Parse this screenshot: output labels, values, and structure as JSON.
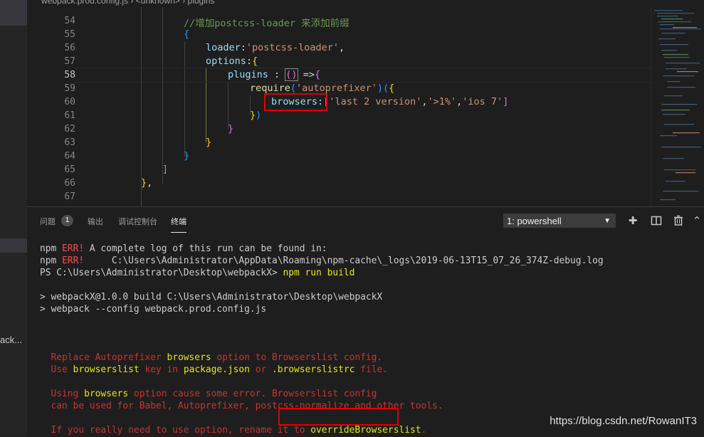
{
  "breadcrumb": {
    "file": "webpack.prod.config.js",
    "sep1": "›",
    "scope": "<unknown>",
    "sep2": "›",
    "symbol": "plugins"
  },
  "left_fragment": "ack...",
  "editor": {
    "lines": [
      {
        "num": "54",
        "comment": "//增加postcss-loader 来添加前缀"
      },
      {
        "num": "55",
        "brace": "{"
      },
      {
        "num": "56",
        "key": "loader",
        "colon": ":",
        "str": "'postcss-loader'",
        "comma": ","
      },
      {
        "num": "57",
        "key": "options",
        "colon": ":",
        "brace": "{"
      },
      {
        "num": "58",
        "key": "plugins",
        "op": " : ",
        "paren": "()",
        "arrow": " =>",
        "brace": "{"
      },
      {
        "num": "59",
        "fn": "require",
        "open": "(",
        "str": "'autoprefixer'",
        "close": ")",
        "paren2": "(",
        "brace": "{"
      },
      {
        "num": "60",
        "key": "browsers",
        "colon": ":",
        "bracket": "[",
        "s1": "'last 2 version'",
        "c": ",",
        "s2": "'>1%'",
        "s3": "'ios 7'",
        "bracket_close": "]"
      },
      {
        "num": "61",
        "brace": "}",
        "paren": ")"
      },
      {
        "num": "62",
        "brace": "}"
      },
      {
        "num": "63",
        "brace": "}"
      },
      {
        "num": "64",
        "brace": "}"
      },
      {
        "num": "65",
        "bracket": "]"
      },
      {
        "num": "66",
        "brace": "}",
        "comma": ","
      },
      {
        "num": "67"
      }
    ]
  },
  "panel": {
    "tabs": {
      "problems": "问题",
      "problems_count": "1",
      "output": "输出",
      "debug": "调试控制台",
      "terminal": "终端"
    },
    "terminal_select": "1: powershell",
    "icons": {
      "add": "plus-icon",
      "split": "split-icon",
      "trash": "trash-icon"
    }
  },
  "terminal": {
    "l1_a": "npm ",
    "l1_err": "ERR!",
    "l1_b": " A complete log of this run can be found in:",
    "l2_a": "npm ",
    "l2_err": "ERR!",
    "l2_b": "     C:\\Users\\Administrator\\AppData\\Roaming\\npm-cache\\_logs\\2019-06-13T15_07_26_374Z-debug.log",
    "l3_a": "PS C:\\Users\\Administrator\\Desktop\\webpackX> ",
    "l3_cmd": "npm run build",
    "l5": "> webpackX@1.0.0 build C:\\Users\\Administrator\\Desktop\\webpackX",
    "l6": "> webpack --config webpack.prod.config.js",
    "w1_a": "  Replace Autoprefixer ",
    "w1_k": "browsers",
    "w1_b": " option to Browserslist config.",
    "w2_a": "  Use ",
    "w2_k1": "browserslist",
    "w2_b": " key in ",
    "w2_k2": "package.json",
    "w2_c": " or ",
    "w2_k3": ".browserslistrc",
    "w2_d": " file.",
    "w3_a": "  Using ",
    "w3_k": "browsers",
    "w3_b": " option cause some error. Browserslist config",
    "w4": "  can be used for Babel, Autoprefixer, postcss-normalize and other tools.",
    "w5_a": "  If you really need to use option, rename it to ",
    "w5_k": "overrideBrowserslist",
    "w5_b": "."
  },
  "watermark": "https://blog.csdn.net/RowanIT3"
}
